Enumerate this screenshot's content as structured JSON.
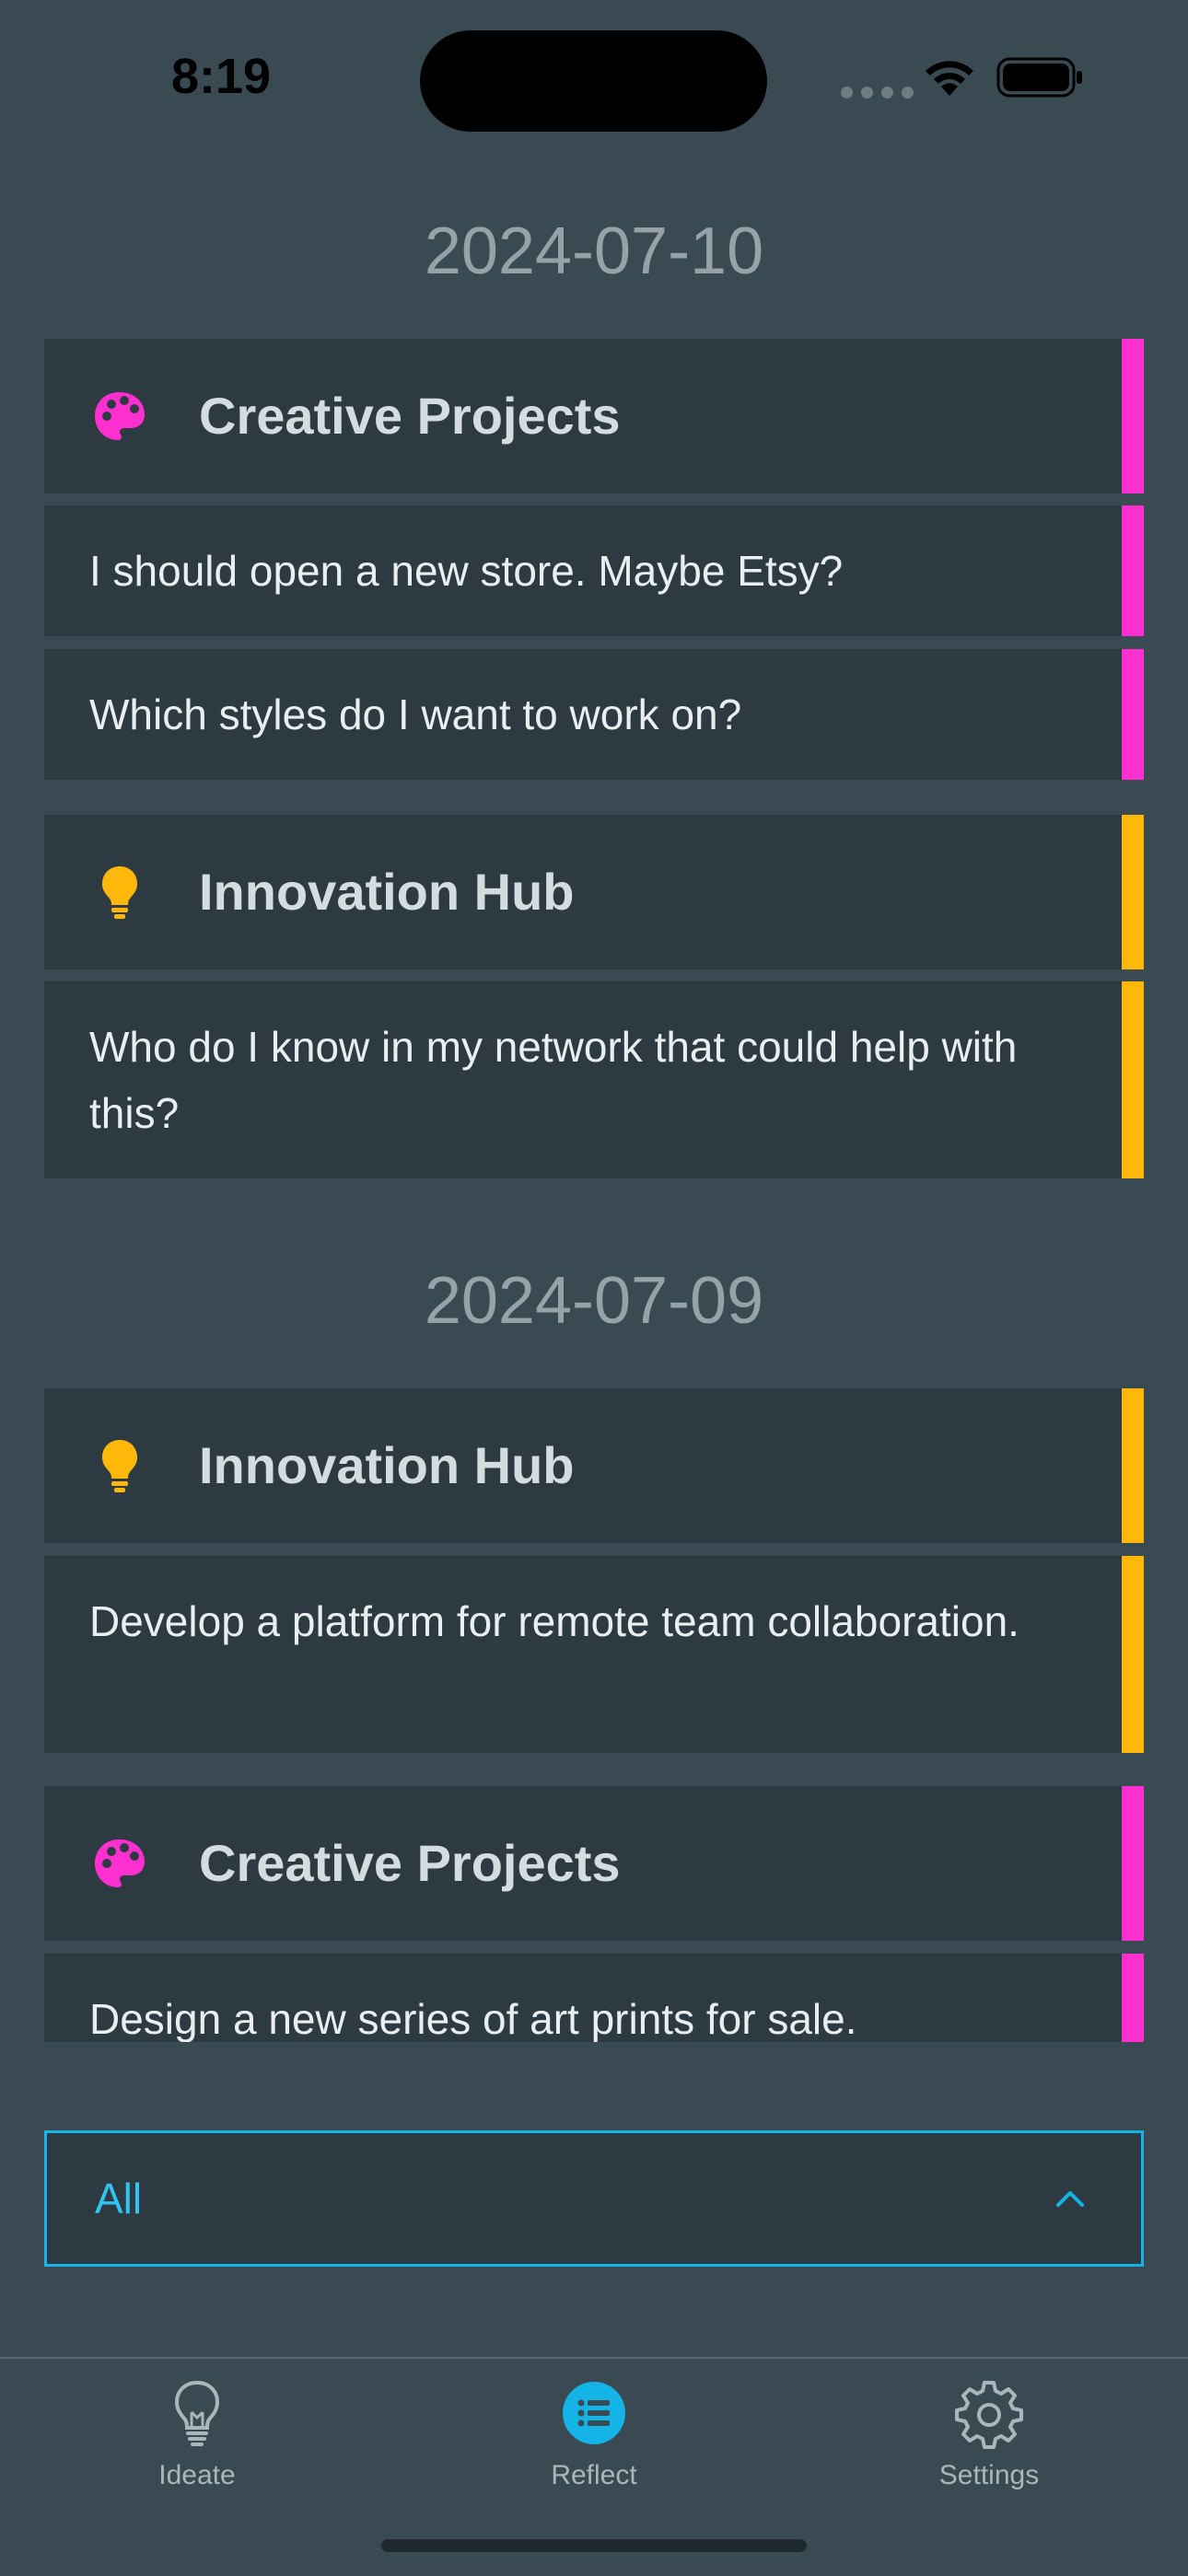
{
  "status_bar": {
    "time": "8:19"
  },
  "groups": [
    {
      "date": "2024-07-10",
      "sections": [
        {
          "category": "Creative Projects",
          "icon": "palette-icon",
          "color": "#ff2fd0",
          "items": [
            "I should open a new store. Maybe Etsy?",
            "Which styles do I want to work on?"
          ]
        },
        {
          "category": "Innovation Hub",
          "icon": "lightbulb-icon",
          "color": "#ffb80a",
          "items": [
            "Who do I know in my network that could help with this?"
          ]
        }
      ]
    },
    {
      "date": "2024-07-09",
      "sections": [
        {
          "category": "Innovation Hub",
          "icon": "lightbulb-icon",
          "color": "#ffb80a",
          "items": [
            "Develop a platform for remote team collaboration."
          ]
        },
        {
          "category": "Creative Projects",
          "icon": "palette-icon",
          "color": "#ff2fd0",
          "items": [
            "Design a new series of art prints for sale."
          ]
        }
      ]
    }
  ],
  "filter": {
    "selected": "All",
    "accent_color": "#14b4e6"
  },
  "tab_bar": {
    "tabs": [
      {
        "label": "Ideate",
        "icon": "lightbulb-outline-icon",
        "active": false
      },
      {
        "label": "Reflect",
        "icon": "list-icon",
        "active": true
      },
      {
        "label": "Settings",
        "icon": "gear-icon",
        "active": false
      }
    ],
    "active_color": "#14b4e6"
  }
}
